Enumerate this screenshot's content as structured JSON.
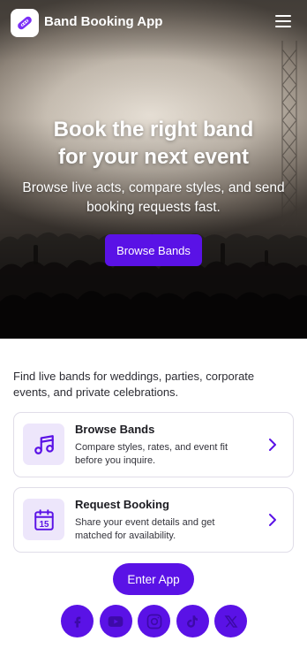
{
  "app": {
    "title": "Band Booking App",
    "logo_icon": "guitar-pick-icon",
    "menu_icon": "hamburger-menu-icon"
  },
  "hero": {
    "title_lines": [
      "Book the right band",
      "for your next event"
    ],
    "subtitle_lines": [
      "Browse live acts, compare styles, and send",
      "booking requests fast."
    ],
    "cta_label": "Browse Bands",
    "background": "concert-crowd-photo"
  },
  "intro": {
    "lines": [
      "Find live bands for weddings, parties, corporate",
      "events, and private celebrations."
    ]
  },
  "cards": [
    {
      "title": "Browse Bands",
      "desc_lines": [
        "Compare styles, rates, and event fit",
        "before you inquire."
      ],
      "icon": "music-note-icon"
    },
    {
      "title": "Request Booking",
      "desc_lines": [
        "Share your event details and get",
        "matched for availability."
      ],
      "icon": "calendar-icon",
      "icon_text": "15"
    }
  ],
  "enter_label": "Enter App",
  "socials": [
    {
      "name": "facebook-icon"
    },
    {
      "name": "youtube-icon"
    },
    {
      "name": "instagram-icon"
    },
    {
      "name": "tiktok-icon"
    },
    {
      "name": "x-icon"
    }
  ],
  "colors": {
    "accent": "#5a12e6",
    "icon_bg": "#ede6fb",
    "card_border": "#e0dde8"
  }
}
